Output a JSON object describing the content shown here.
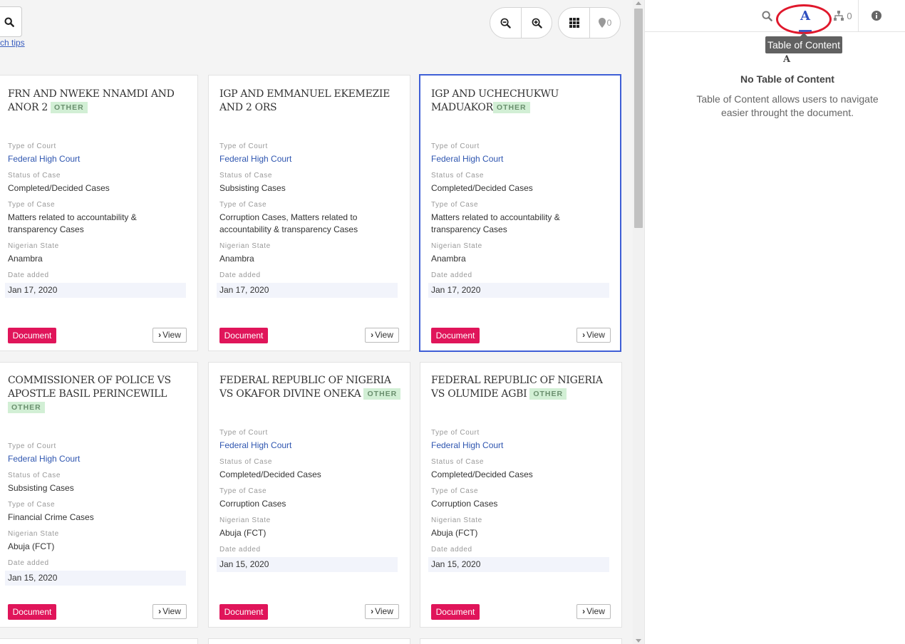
{
  "toolbar": {
    "search_tips": "ch tips",
    "pin_count": "0"
  },
  "cards": [
    {
      "title": "FRN AND NWEKE NNAMDI AND ANOR 2",
      "badge": "OTHER",
      "fields": [
        {
          "label": "Type of Court",
          "value": "Federal High Court"
        },
        {
          "label": "Status of Case",
          "value": "Completed/Decided Cases"
        },
        {
          "label": "Type of Case",
          "value": "Matters related to accountability & transparency Cases"
        },
        {
          "label": "Nigerian State",
          "value": "Anambra"
        },
        {
          "label": "Date added",
          "value": "Jan 17, 2020"
        }
      ],
      "doc_label": "Document",
      "view_label": "View"
    },
    {
      "title": "IGP AND EMMANUEL EKEMEZIE AND 2 ORS",
      "badge": "",
      "fields": [
        {
          "label": "Type of Court",
          "value": "Federal High Court"
        },
        {
          "label": "Status of Case",
          "value": "Subsisting Cases"
        },
        {
          "label": "Type of Case",
          "value": "Corruption Cases, Matters related to accountability & transparency Cases"
        },
        {
          "label": "Nigerian State",
          "value": "Anambra"
        },
        {
          "label": "Date added",
          "value": "Jan 17, 2020"
        }
      ],
      "doc_label": "Document",
      "view_label": "View"
    },
    {
      "title": "IGP AND UCHECHUKWU MADUAKOR",
      "badge": "OTHER",
      "fields": [
        {
          "label": "Type of Court",
          "value": "Federal High Court"
        },
        {
          "label": "Status of Case",
          "value": "Completed/Decided Cases"
        },
        {
          "label": "Type of Case",
          "value": "Matters related to accountability & transparency Cases"
        },
        {
          "label": "Nigerian State",
          "value": "Anambra"
        },
        {
          "label": "Date added",
          "value": "Jan 17, 2020"
        }
      ],
      "doc_label": "Document",
      "view_label": "View"
    },
    {
      "title": "COMMISSIONER OF POLICE VS APOSTLE BASIL PERINCEWILL",
      "badge": "OTHER",
      "fields": [
        {
          "label": "Type of Court",
          "value": "Federal High Court"
        },
        {
          "label": "Status of Case",
          "value": "Subsisting Cases"
        },
        {
          "label": "Type of Case",
          "value": "Financial Crime Cases"
        },
        {
          "label": "Nigerian State",
          "value": "Abuja (FCT)"
        },
        {
          "label": "Date added",
          "value": "Jan 15, 2020"
        }
      ],
      "doc_label": "Document",
      "view_label": "View"
    },
    {
      "title": "FEDERAL REPUBLIC OF NIGERIA VS OKAFOR DIVINE ONEKA",
      "badge": "OTHER",
      "fields": [
        {
          "label": "Type of Court",
          "value": "Federal High Court"
        },
        {
          "label": "Status of Case",
          "value": "Completed/Decided Cases"
        },
        {
          "label": "Type of Case",
          "value": "Corruption Cases"
        },
        {
          "label": "Nigerian State",
          "value": "Abuja (FCT)"
        },
        {
          "label": "Date added",
          "value": "Jan 15, 2020"
        }
      ],
      "doc_label": "Document",
      "view_label": "View"
    },
    {
      "title": "FEDERAL REPUBLIC OF NIGERIA VS OLUMIDE AGBI",
      "badge": "OTHER",
      "fields": [
        {
          "label": "Type of Court",
          "value": "Federal High Court"
        },
        {
          "label": "Status of Case",
          "value": "Completed/Decided Cases"
        },
        {
          "label": "Type of Case",
          "value": "Corruption Cases"
        },
        {
          "label": "Nigerian State",
          "value": "Abuja (FCT)"
        },
        {
          "label": "Date added",
          "value": "Jan 15, 2020"
        }
      ],
      "doc_label": "Document",
      "view_label": "View"
    }
  ],
  "side_panel": {
    "toc_tab_letter": "A",
    "tree_count": "0",
    "tooltip": "Table of Content",
    "stray_letter": "A",
    "empty_title": "No Table of Content",
    "empty_description": "Table of Content allows users to navigate easier throught the document."
  },
  "colors": {
    "accent_blue": "#3f5fd6",
    "document_button": "#e0155a",
    "badge_bg": "#d2efd5",
    "link": "#2f56b0",
    "annotation_circle": "#e0182c"
  }
}
